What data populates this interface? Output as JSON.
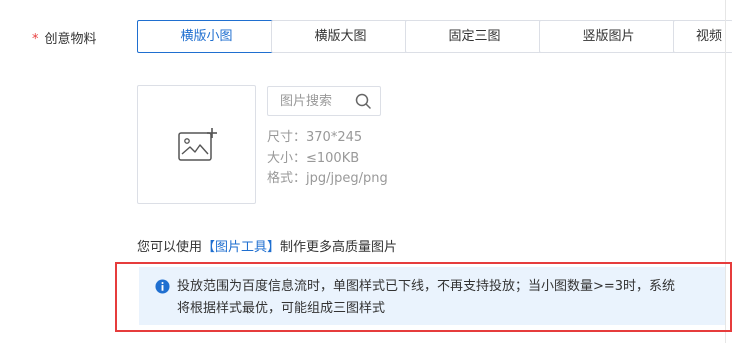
{
  "field": {
    "required_mark": "*",
    "label": "创意物料"
  },
  "format_tabs": [
    {
      "label": "横版小图",
      "active": true
    },
    {
      "label": "横版大图",
      "active": false
    },
    {
      "label": "固定三图",
      "active": false
    },
    {
      "label": "竖版图片",
      "active": false
    },
    {
      "label": "视频",
      "active": false
    }
  ],
  "upload": {
    "icon": "add-image-icon"
  },
  "search": {
    "placeholder": "图片搜索",
    "value": "",
    "icon": "search-icon"
  },
  "specs": {
    "size": "尺寸：370*245",
    "filesize": "大小：≤100KB",
    "format": "格式：jpg/jpeg/png"
  },
  "tip": {
    "prefix": "您可以使用",
    "link": "【图片工具】",
    "suffix": "制作更多高质量图片"
  },
  "notice": {
    "icon": "info-icon",
    "line1": "投放范围为百度信息流时，单图样式已下线，不再支持投放；当小图数量>=3时，系统",
    "line2": "将根据样式最优，可能组成三图样式"
  },
  "colors": {
    "accent": "#1f6fd0",
    "required": "#e83f3f",
    "highlight_border": "#e63c3c",
    "notice_bg": "#eaf3fd"
  }
}
